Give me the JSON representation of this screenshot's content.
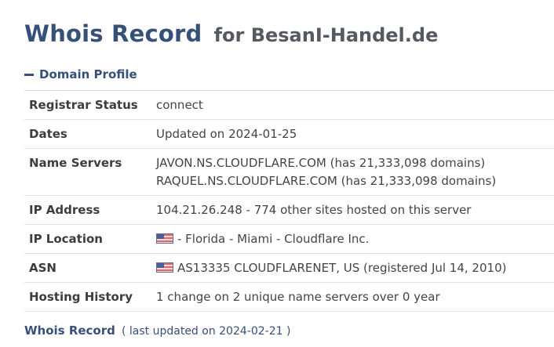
{
  "header": {
    "title": "Whois Record",
    "subtitle": "for BesanI-Handel.de"
  },
  "section": {
    "label": "Domain Profile"
  },
  "rows": [
    {
      "label": "Registrar Status",
      "value": "connect"
    },
    {
      "label": "Dates",
      "value": "Updated on 2024-01-25"
    },
    {
      "label": "Name Servers",
      "lines": [
        "JAVON.NS.CLOUDFLARE.COM (has 21,333,098 domains)",
        "RAQUEL.NS.CLOUDFLARE.COM (has 21,333,098 domains)"
      ]
    },
    {
      "label": "IP Address",
      "value": "104.21.26.248 - 774 other sites hosted on this server"
    },
    {
      "label": "IP Location",
      "value": "- Florida - Miami - Cloudflare Inc.",
      "icon": "us-flag-icon"
    },
    {
      "label": "ASN",
      "value": "AS13335 CLOUDFLARENET, US (registered Jul 14, 2010)",
      "icon": "us-flag-icon"
    },
    {
      "label": "Hosting History",
      "value": "1 change on 2 unique name servers over 0 year"
    }
  ],
  "footer": {
    "title": "Whois Record",
    "note": "( last updated on 2024-02-21 )"
  },
  "colors": {
    "heading": "#36507a",
    "text": "#444444",
    "divider": "#e1e1e1"
  }
}
